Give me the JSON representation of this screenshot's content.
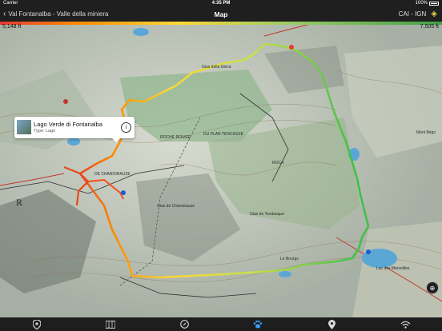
{
  "status": {
    "carrier": "Carrier",
    "time": "4:35 PM",
    "battery": "100%"
  },
  "nav": {
    "back_label": "Val Fontanalba - Valle della miniera",
    "title": "Map",
    "layer_label": "CAI - IGN"
  },
  "elevation": {
    "min_label": "5,148 ft",
    "max_label": "7,505 ft"
  },
  "callout": {
    "name": "Lago Verde di Fontanalba",
    "type": "Type: Lago"
  },
  "map_labels": [
    "DE CHANOIRAUZE",
    "ROCHE ROUGE",
    "DU PLAN TENCASSE",
    "Gias de Chanoirauze",
    "Gias de Tendasque",
    "Gias della Gerra",
    "Lac Vert",
    "Lac des Merveilles",
    "Le Bourgs",
    "Mont Bégo",
    "ROCA",
    "R"
  ],
  "tabs": [
    {
      "name": "map-pin-tab",
      "icon": "pin-icon"
    },
    {
      "name": "map-book-tab",
      "icon": "map-icon"
    },
    {
      "name": "compass-tab",
      "icon": "compass-icon"
    },
    {
      "name": "paw-tab",
      "icon": "paw-icon"
    },
    {
      "name": "location-tab",
      "icon": "location-pin-icon"
    },
    {
      "name": "wifi-tab",
      "icon": "wifi-icon"
    }
  ],
  "colors": {
    "track_start": "#e53935",
    "track_end": "#43a047",
    "active_tab": "#3aa0ff"
  }
}
